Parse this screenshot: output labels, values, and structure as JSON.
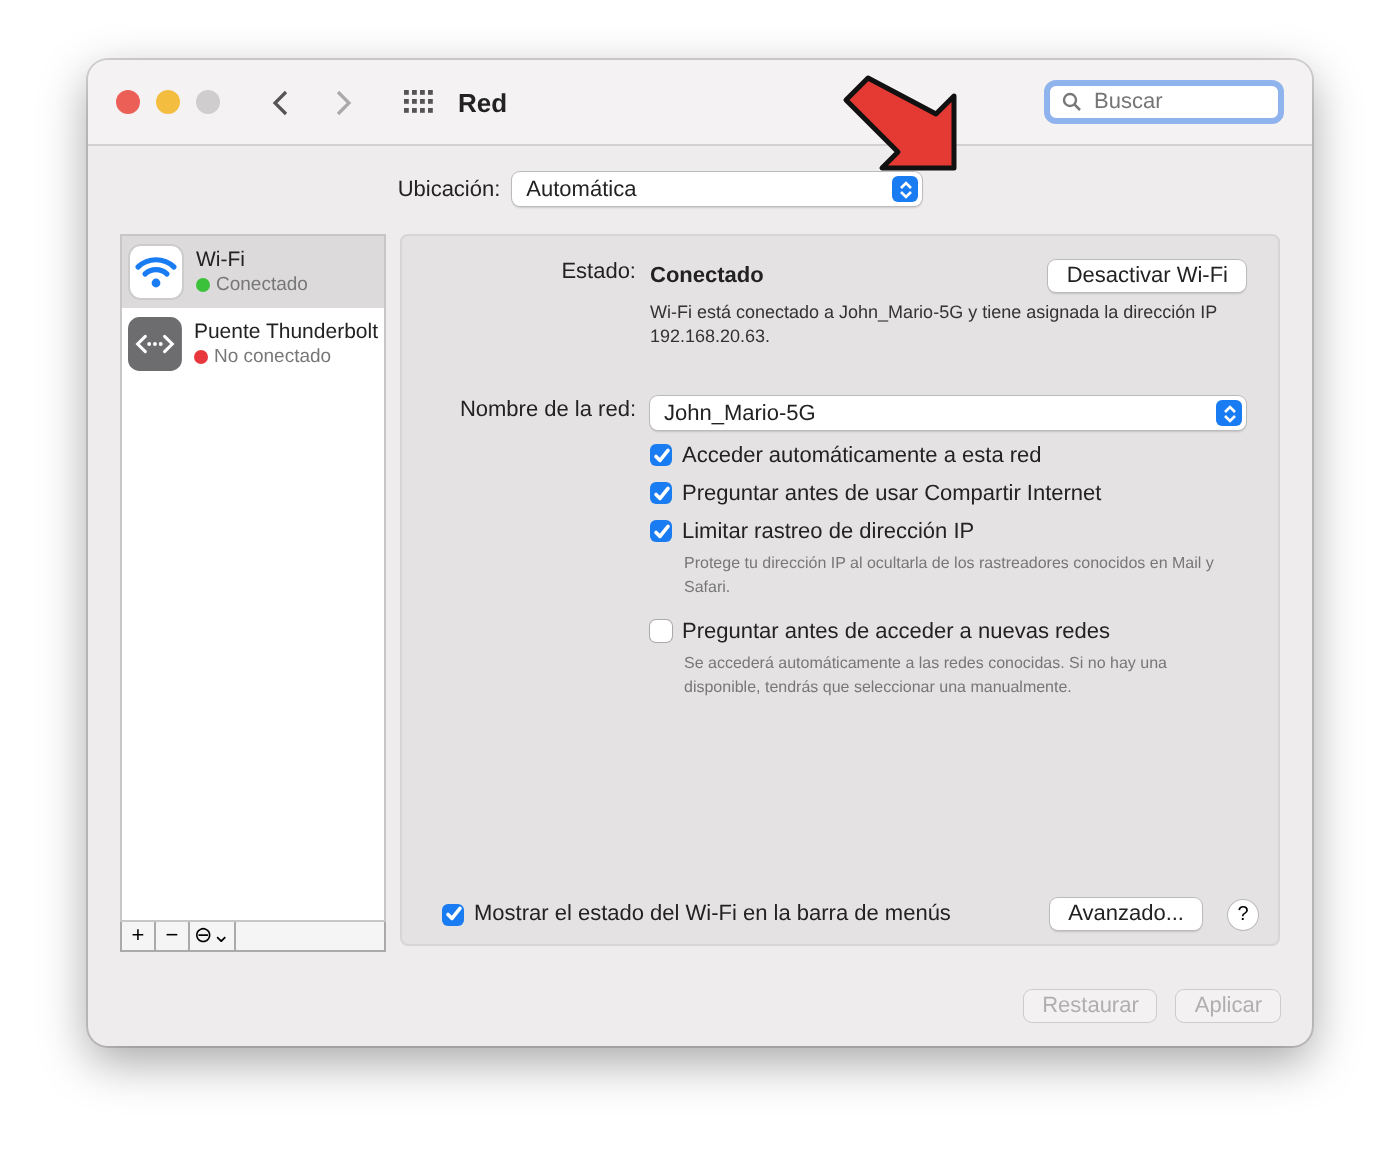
{
  "window": {
    "title": "Red"
  },
  "search": {
    "placeholder": "Buscar"
  },
  "location": {
    "label": "Ubicación:",
    "value": "Automática"
  },
  "annotation": {
    "kind": "arrow"
  },
  "services": [
    {
      "name": "Wi-Fi",
      "status": "Conectado",
      "color": "#3cc13b",
      "kind": "wifi",
      "selected": true
    },
    {
      "name": "Puente Thunderbolt",
      "status": "No conectado",
      "color": "#e8383d",
      "kind": "bridge",
      "selected": false
    }
  ],
  "list_buttons": [
    "+",
    "−",
    "⊖⌄"
  ],
  "status": {
    "label": "Estado:",
    "value": "Conectado",
    "button": "Desactivar Wi-Fi",
    "description": "Wi-Fi está conectado a John_Mario-5G y tiene asignada la dirección IP 192.168.20.63."
  },
  "network_name": {
    "label": "Nombre de la red:",
    "value": "John_Mario-5G"
  },
  "options": [
    {
      "label": "Acceder automáticamente a esta red",
      "checked": true
    },
    {
      "label": "Preguntar antes de usar Compartir Internet",
      "checked": true
    },
    {
      "label": "Limitar rastreo de dirección IP",
      "checked": true,
      "note": "Protege tu dirección IP al ocultarla de los rastreadores conocidos en Mail y Safari."
    },
    {
      "label": "Preguntar antes de acceder a nuevas redes",
      "checked": false,
      "note": "Se accederá automáticamente a las redes conocidas. Si no hay una disponible, tendrás que seleccionar una manualmente."
    }
  ],
  "show_in_menu": {
    "label": "Mostrar el estado del Wi-Fi en la barra de menús",
    "checked": true
  },
  "advanced_button": "Avanzado...",
  "help_button": "?",
  "footer_buttons": [
    {
      "label": "Restaurar",
      "disabled": true
    },
    {
      "label": "Aplicar",
      "disabled": true
    }
  ]
}
